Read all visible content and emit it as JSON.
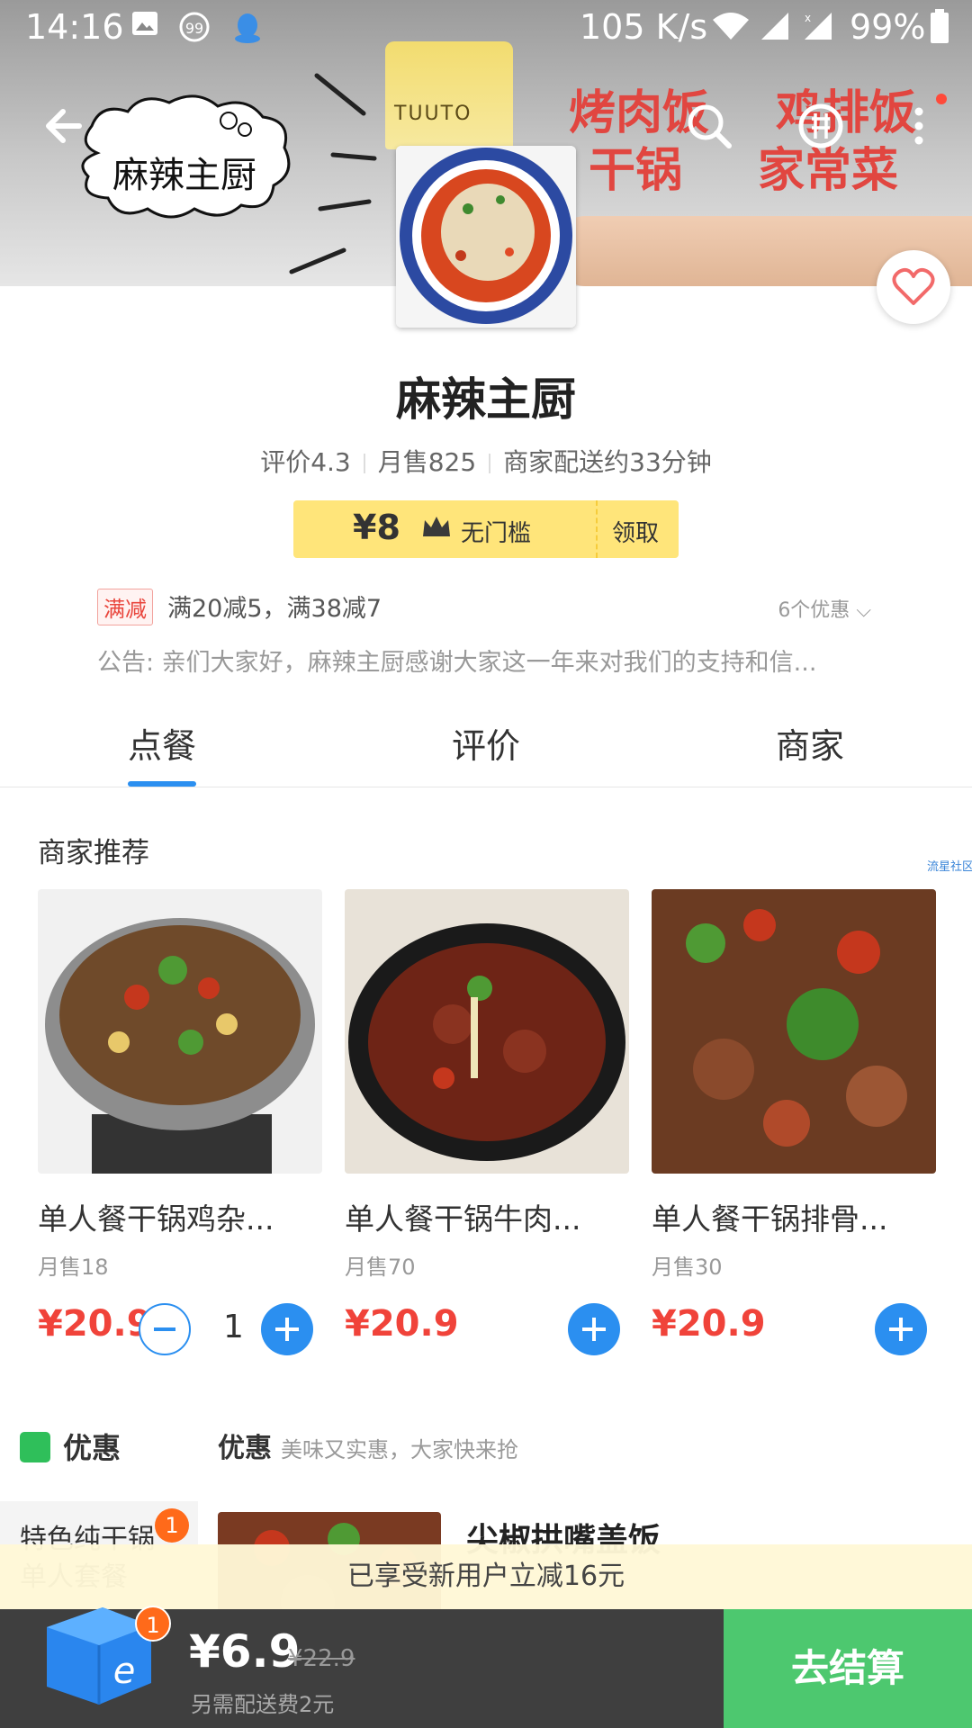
{
  "status_bar": {
    "time": "14:16",
    "network_speed": "105 K/s",
    "battery": "99%"
  },
  "banner": {
    "logo_text": "麻辣主厨",
    "cup_brand": "TUUTO",
    "promo_lines": [
      "烤肉饭",
      "鸡排饭",
      "干锅",
      "家常菜"
    ]
  },
  "shop": {
    "name": "麻辣主厨",
    "rating": "评价4.3",
    "monthly_sales": "月售825",
    "delivery": "商家配送约33分钟"
  },
  "coupon": {
    "amount": "¥8",
    "condition": "无门槛",
    "claim": "领取"
  },
  "discount": {
    "tag": "满减",
    "text": "满20减5，满38减7",
    "more": "6个优惠"
  },
  "notice": "公告: 亲们大家好，麻辣主厨感谢大家这一年来对我们的支持和信...",
  "tabs": [
    "点餐",
    "评价",
    "商家"
  ],
  "recommend": {
    "title": "商家推荐",
    "watermark": "流星社区",
    "items": [
      {
        "name": "单人餐干锅鸡杂...",
        "sales": "月售18",
        "price": "¥20.9",
        "qty": "1"
      },
      {
        "name": "单人餐干锅牛肉...",
        "sales": "月售70",
        "price": "¥20.9"
      },
      {
        "name": "单人餐干锅排骨...",
        "sales": "月售30",
        "price": "¥20.9"
      }
    ]
  },
  "section": {
    "left_title": "优惠",
    "right_title": "优惠",
    "right_sub": "美味又实惠，大家快来抢",
    "category_label": "特色纯干锅单人套餐",
    "category_badge": "1",
    "food_name": "尖椒拱嘴盖饭"
  },
  "new_user_banner": "已享受新用户立减16元",
  "cart": {
    "badge": "1",
    "price": "¥6.9",
    "original": "¥22.9",
    "fee_note": "另需配送费2元",
    "checkout": "去结算"
  },
  "colors": {
    "accent_blue": "#2b8ff0",
    "price_red": "#f0433a",
    "checkout_green": "#4dc86f",
    "coupon_yellow": "#ffe57a"
  }
}
